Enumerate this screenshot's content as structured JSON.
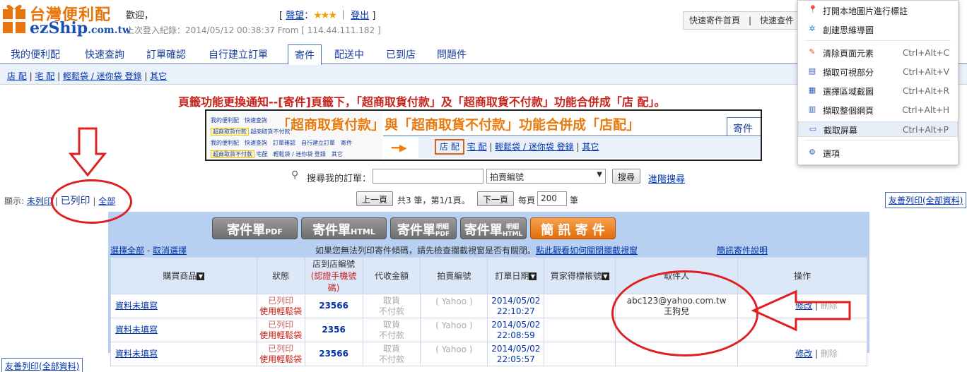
{
  "header": {
    "brand_zh": "台灣便利配",
    "welcome": "歡迎，",
    "brand_en": "ezShip",
    "brand_en_suffix": ".com.tw",
    "last_login": "上次登入紀錄：2014/05/12 00:38:37 From [ 114.44.111.182 ]",
    "rating_label": "聲望",
    "rating_stars": "★★★",
    "logout_label": "登出",
    "quick_links": "快速寄件首頁　|　快速查件"
  },
  "tabs": [
    "我的便利配",
    "快速查詢",
    "訂單確認",
    "自行建立訂單",
    "寄件",
    "配送中",
    "已到店",
    "問題件"
  ],
  "subnav": {
    "store": "店 配",
    "home": "宅 配",
    "bag": "輕鬆袋 / 迷你袋 登錄",
    "other": "其它"
  },
  "notice": "頁籤功能更換通知--[寄件]頁籤下，「超商取貨付款」及「超商取貨不付款」功能合併成「店 配」。",
  "promo": {
    "headline": "「超商取貨付款」與「超商取貨不付款」功能合併成「店配」",
    "tab": "寄件",
    "store": "店 配",
    "home": "宅 配",
    "bag": "輕鬆袋 / 迷你袋 登錄",
    "other": "其它",
    "mini_row1": "我的便利配　快速查詢",
    "mini_row2_a": "超商取貨付款",
    "mini_row2_b": "超商取貨不付款",
    "mini_row3": "我的便利配　快速查詢　訂單確認　自行建立訂單　寄件",
    "mini_row4_a": "超商取貨不付款",
    "mini_row4_b": "宅配　輕鬆袋 / 迷你袋 登錄　其它"
  },
  "search": {
    "label": "搜尋我的訂單：",
    "value": "",
    "select_value": "拍賣編號",
    "button": "搜尋",
    "advanced": "進階搜尋"
  },
  "filter": {
    "prefix": "顯示:",
    "unprinted": "未列印",
    "printed": "已列印",
    "all": "全部"
  },
  "pager": {
    "prev": "上一頁",
    "info": "共3 筆，第1/1頁。",
    "next": "下一頁",
    "per_page_label": "每頁",
    "per_page_value": "200",
    "per_page_unit": "筆"
  },
  "friendly_print": "友善列印(全部資料)",
  "buttons": {
    "pdf_main": "寄件單",
    "pdf_sub": "PDF",
    "html_main": "寄件單",
    "html_sub": "HTML",
    "dpdf_main": "寄件單",
    "dpdf_s1": "明細",
    "dpdf_s2": "PDF",
    "dhtml_main": "寄件單",
    "dhtml_s1": "明細",
    "dhtml_s2": "HTML",
    "sms": "簡 訊 寄 件"
  },
  "selection": {
    "select_all": "選擇全部",
    "deselect": "取消選擇",
    "popup_note": "如果您無法列印寄件傾碼，請先檢查攔截視窗是否有關閉。",
    "popup_link": "點此觀看如何關閉攔截視窗",
    "sms_help": "簡訊寄件說明"
  },
  "table": {
    "headers": {
      "product": "購買商品",
      "status": "狀態",
      "store_no": "店到店編號",
      "store_no_sub": "(認證手機號碼)",
      "cod": "代收金額",
      "auction": "拍賣編號",
      "date": "訂單日期",
      "buyer": "買家得標帳號",
      "receiver": "取件人",
      "action": "操作"
    },
    "rows": [
      {
        "product": "資料未填寫",
        "status": "已列印",
        "bag": "使用輕鬆袋",
        "store_no": "23566",
        "cod1": "取貨",
        "cod2": "不付款",
        "auction": "( Yahoo )",
        "date": "2014/05/02",
        "time": "22:10:27",
        "buyer": "",
        "receiver1": "abc123@yahoo.com.tw",
        "receiver2": "王狗兒",
        "edit": "修改",
        "del": "刪除"
      },
      {
        "product": "資料未填寫",
        "status": "已列印",
        "bag": "使用輕鬆袋",
        "store_no": "2356",
        "cod1": "取貨",
        "cod2": "不付款",
        "auction": "( Yahoo )",
        "date": "2014/05/02",
        "time": "22:08:59",
        "buyer": "",
        "receiver1": "",
        "receiver2": "",
        "edit": "",
        "del": ""
      },
      {
        "product": "資料未填寫",
        "status": "已列印",
        "bag": "使用輕鬆袋",
        "store_no": "23566",
        "cod1": "取貨",
        "cod2": "不付款",
        "auction": "( Yahoo )",
        "date": "2014/05/02",
        "time": "22:05:57",
        "buyer": "",
        "receiver1": "",
        "receiver2": "",
        "edit": "修改",
        "del": "刪除"
      }
    ]
  },
  "context_menu": {
    "items": [
      {
        "label": "打開本地圖片進行標註",
        "shortcut": "",
        "icon": "pin-icon"
      },
      {
        "label": "創建思維導圖",
        "shortcut": "",
        "icon": "mindmap-icon"
      },
      {
        "label": "清除頁面元素",
        "shortcut": "Ctrl+Alt+C",
        "icon": "eraser-icon"
      },
      {
        "label": "擷取可視部分",
        "shortcut": "Ctrl+Alt+V",
        "icon": "page-icon"
      },
      {
        "label": "選擇區域截圖",
        "shortcut": "Ctrl+Alt+R",
        "icon": "crop-icon"
      },
      {
        "label": "擷取整個網頁",
        "shortcut": "Ctrl+Alt+H",
        "icon": "fullpage-icon"
      },
      {
        "label": "截取屏幕",
        "shortcut": "Ctrl+Alt+P",
        "icon": "screen-icon"
      },
      {
        "label": "選項",
        "shortcut": "",
        "icon": "settings-icon"
      }
    ]
  },
  "colors": {
    "accent_blue": "#1a3f9e",
    "notice_red": "#c8221a",
    "orange": "#e87b10",
    "annotation_red": "#e02020",
    "panel_bg": "#b7cff0"
  }
}
